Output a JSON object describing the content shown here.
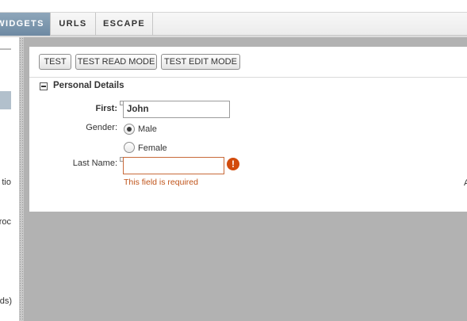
{
  "tabs": [
    {
      "label": "WIDGETS",
      "active": true
    },
    {
      "label": "URLS",
      "active": false
    },
    {
      "label": "ESCAPE",
      "active": false
    }
  ],
  "sidebar": {
    "fragments": [
      "tio",
      "roc",
      "ds)"
    ]
  },
  "toolbar": {
    "test_label": "TEST",
    "test_read_label": "TEST READ MODE",
    "test_edit_label": "TEST EDIT MODE"
  },
  "section": {
    "title": "Personal Details"
  },
  "form": {
    "first_label": "First:",
    "first_value": "John",
    "gender_label": "Gender:",
    "gender_options": [
      "Male",
      "Female"
    ],
    "gender_selected": "Male",
    "last_label": "Last Name:",
    "last_value": "",
    "error_text": "This field is required",
    "error_icon_glyph": "!"
  },
  "edge_fragment": "A",
  "colors": {
    "active_tab": "#7f98ae",
    "error": "#d24b0c",
    "canvas_gray": "#b2b2b2"
  }
}
